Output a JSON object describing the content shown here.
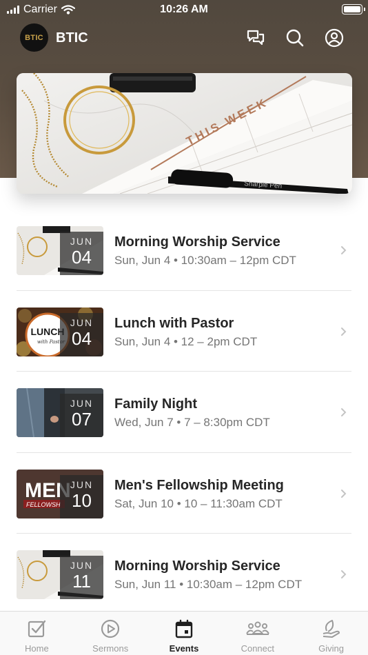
{
  "status_bar": {
    "carrier": "Carrier",
    "time": "10:26 AM"
  },
  "app_bar": {
    "logo_text": "BTIC",
    "app_name": "BTIC"
  },
  "hero": {
    "text": "THIS WEEK"
  },
  "events": [
    {
      "title": "Morning Worship Service",
      "meta": "Sun, Jun 4 • 10:30am – 12pm CDT",
      "month": "JUN",
      "day": "04"
    },
    {
      "title": "Lunch with Pastor",
      "meta": "Sun, Jun 4 • 12 – 2pm CDT",
      "month": "JUN",
      "day": "04"
    },
    {
      "title": "Family Night",
      "meta": "Wed, Jun 7 • 7 – 8:30pm CDT",
      "month": "JUN",
      "day": "07"
    },
    {
      "title": "Men's Fellowship Meeting",
      "meta": "Sat, Jun 10 • 10 – 11:30am CDT",
      "month": "JUN",
      "day": "10"
    },
    {
      "title": "Morning Worship Service",
      "meta": "Sun, Jun 11 • 10:30am – 12pm CDT",
      "month": "JUN",
      "day": "11"
    }
  ],
  "thumb_text": {
    "lunch": "LUNCH",
    "mens": "MEN"
  },
  "tabs": [
    {
      "label": "Home",
      "icon": "checkbox-icon"
    },
    {
      "label": "Sermons",
      "icon": "play-circle-icon"
    },
    {
      "label": "Events",
      "icon": "calendar-icon",
      "active": true
    },
    {
      "label": "Connect",
      "icon": "people-icon"
    },
    {
      "label": "Giving",
      "icon": "leaf-hand-icon"
    }
  ],
  "colors": {
    "header": "#5b4e41",
    "accent": "#c9a24b",
    "active_tab": "#1f1f1f",
    "inactive_tab": "#9a9a9a"
  }
}
